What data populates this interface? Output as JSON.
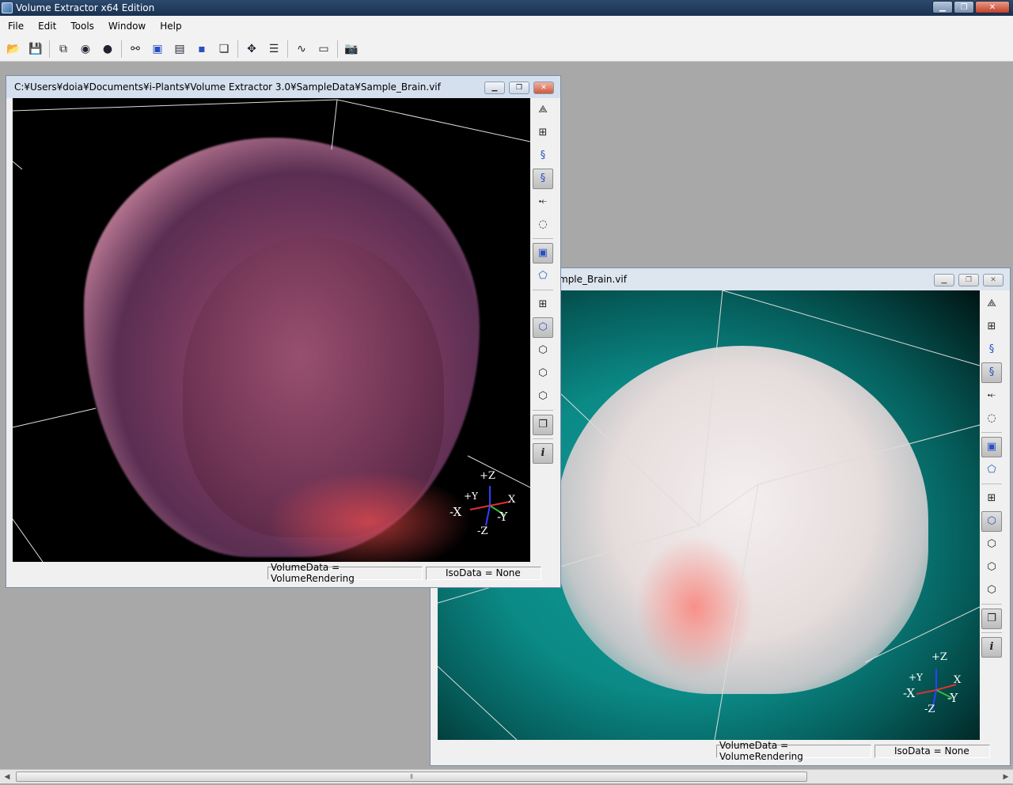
{
  "app": {
    "title": "Volume Extractor x64 Edition"
  },
  "menu": [
    "File",
    "Edit",
    "Tools",
    "Window",
    "Help"
  ],
  "window1": {
    "title": "C:¥Users¥doia¥Documents¥i-Plants¥Volume Extractor 3.0¥SampleData¥Sample_Brain.vif",
    "status_volume": "VolumeData = VolumeRendering",
    "status_iso": "IsoData = None"
  },
  "window2": {
    "title": "mple_Brain.vif",
    "status_volume": "VolumeData = VolumeRendering",
    "status_iso": "IsoData = None"
  },
  "axes": {
    "pz": "+Z",
    "py": "+Y",
    "px": "X",
    "nx": "-X",
    "ny": "-Y",
    "nz": "-Z"
  },
  "colors": {
    "titlebar": "#1f3a5c",
    "viewport_bg": "#000000",
    "teal": "#0b8a86"
  },
  "icons": {
    "toolbar": [
      "open-folder-icon",
      "save-icon",
      "frame-icon",
      "zoom-icon",
      "sphere-icon",
      "link-icon",
      "cube-blue-icon",
      "cube-pb-icon",
      "cube-small-icon",
      "layers-icon",
      "move-icon",
      "list-icon",
      "graph-icon",
      "ruler-icon",
      "camera-icon"
    ]
  }
}
